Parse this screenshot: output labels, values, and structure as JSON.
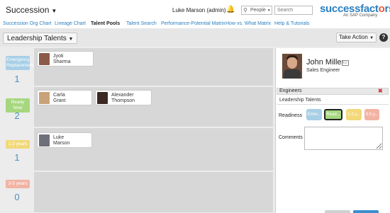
{
  "app": {
    "module_label": "Succession",
    "user_label": "Luke Marson (admin)",
    "search_scope": "People",
    "search_placeholder": "Search",
    "logo": {
      "success": "success",
      "fact": "fact",
      "o": "o",
      "rs": "rs",
      "tagline": "An SAP Company"
    }
  },
  "nav": [
    "Succession Org Chart",
    "Lineage Chart",
    "Talent Pools",
    "Talent Search",
    "Performance-Potential Matrix",
    "How vs. What Matrix",
    "Help & Tutorials"
  ],
  "nav_active": "Talent Pools",
  "toolbar": {
    "pool_select": "Leadership Talents",
    "take_action": "Take Action",
    "help": "?"
  },
  "colors": {
    "emergency": "#a7cfe6",
    "ready_now": "#a6d77f",
    "one_two": "#f2d97a",
    "three_five": "#f2b3a3",
    "link": "#2a7fc1"
  },
  "rows": [
    {
      "badge": "Emergency Replacement",
      "count": "1",
      "color": "#a7cfe6",
      "people": [
        {
          "first": "Jyoti",
          "last": "Sharma",
          "avatar_color": "#8a5a46"
        }
      ]
    },
    {
      "badge": "Ready Now",
      "count": "2",
      "color": "#a6d77f",
      "people": [
        {
          "first": "Carla",
          "last": "Grant",
          "avatar_color": "#c9a27a"
        },
        {
          "first": "Alexander",
          "last": "Thompson",
          "avatar_color": "#3b2a22"
        }
      ]
    },
    {
      "badge": "1-2 years",
      "count": "1",
      "color": "#f2d97a",
      "people": [
        {
          "first": "Luke",
          "last": "Marson",
          "avatar_color": "#6f6f7a"
        }
      ]
    },
    {
      "badge": "3-5 years",
      "count": "0",
      "color": "#f2b3a3",
      "people": []
    }
  ],
  "detail": {
    "name": "John Miller",
    "title": "Sales Engineer",
    "section": "Engineers",
    "pool": "Leadership Talents",
    "readiness_label": "Readiness",
    "comments_label": "Comments",
    "readiness_options": [
      {
        "label": "Emer...",
        "color": "#a7cfe6",
        "selected": false
      },
      {
        "label": "Read...",
        "color": "#a6d77f",
        "selected": true
      },
      {
        "label": "1-2 y...",
        "color": "#f2d97a",
        "selected": false
      },
      {
        "label": "3-5 y...",
        "color": "#f2b3a3",
        "selected": false
      }
    ]
  }
}
